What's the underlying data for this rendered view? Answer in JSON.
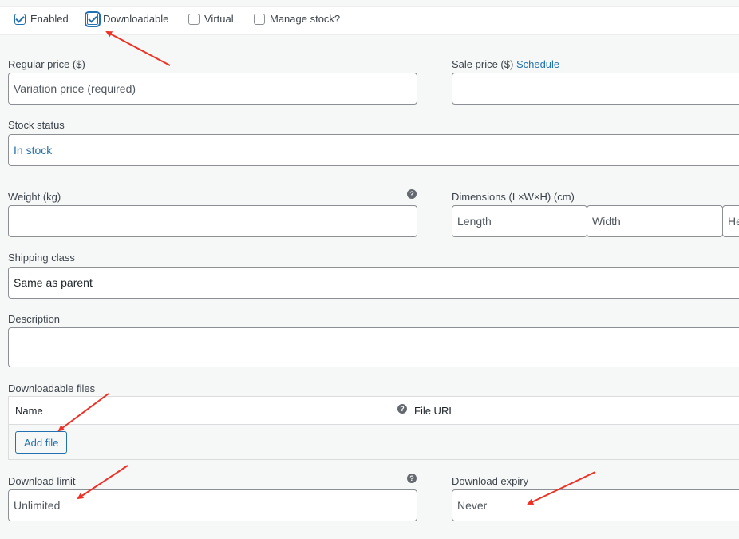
{
  "options": {
    "enabled": {
      "label": "Enabled",
      "checked": true
    },
    "downloadable": {
      "label": "Downloadable",
      "checked": true
    },
    "virtual": {
      "label": "Virtual",
      "checked": false
    },
    "manage_stock": {
      "label": "Manage stock?",
      "checked": false
    }
  },
  "regular_price": {
    "label": "Regular price ($)",
    "placeholder": "Variation price (required)"
  },
  "sale_price": {
    "label": "Sale price ($)",
    "link": "Schedule",
    "value": ""
  },
  "stock_status": {
    "label": "Stock status",
    "value": "In stock"
  },
  "weight": {
    "label": "Weight (kg)",
    "value": ""
  },
  "dimensions": {
    "label": "Dimensions (L×W×H) (cm)",
    "length": "Length",
    "width": "Width",
    "height": "Height"
  },
  "shipping_class": {
    "label": "Shipping class",
    "value": "Same as parent"
  },
  "description": {
    "label": "Description",
    "value": ""
  },
  "downloadable_files": {
    "label": "Downloadable files",
    "columns": [
      "Name",
      "File URL"
    ],
    "add_button": "Add file"
  },
  "download_limit": {
    "label": "Download limit",
    "placeholder": "Unlimited"
  },
  "download_expiry": {
    "label": "Download expiry",
    "placeholder": "Never"
  },
  "help_glyph": "?",
  "colors": {
    "accent": "#2271b1",
    "annotation": "#ee3124"
  }
}
